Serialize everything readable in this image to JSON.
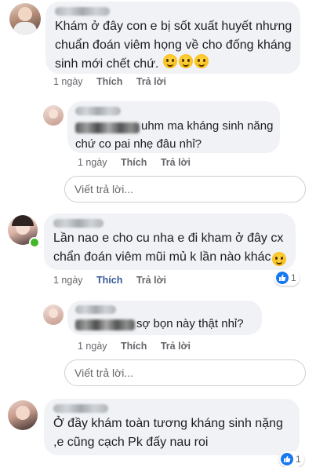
{
  "comments": [
    {
      "text": "Khám ở đây con e bị sốt xuất huyết nhưng chuẩn đoán viêm họng về cho đống kháng sinh mới chết chứ.",
      "time": "1 ngày",
      "like_label": "Thích",
      "reply_label": "Trả lời"
    },
    {
      "text": "uhm ma kháng sinh năng chứ co pai nhẹ đâu nhỉ?",
      "time": "1 ngày",
      "like_label": "Thích",
      "reply_label": "Trả lời"
    },
    {
      "text": "Lần nao e cho cu nha e đi kham ở đây cx chẩn đoán viêm mũi mủ k lần nào khác",
      "time": "1 ngày",
      "like_label": "Thích",
      "reply_label": "Trả lời",
      "reaction_count": "1"
    },
    {
      "text": "sợ bọn này thật nhỉ?",
      "time": "1 ngày",
      "like_label": "Thích",
      "reply_label": "Trả lời"
    },
    {
      "text": "Ở đầy khám toàn tương kháng sinh nặng ,e cũng cạch Pk đấy nau roi",
      "reaction_count": "1"
    }
  ],
  "reply_inputs": [
    {
      "placeholder": "Viết trả lời..."
    },
    {
      "placeholder": "Viết trả lời..."
    }
  ],
  "colors": {
    "bubble": "#f0f2f5",
    "liked": "#385898",
    "online": "#42b72a"
  }
}
